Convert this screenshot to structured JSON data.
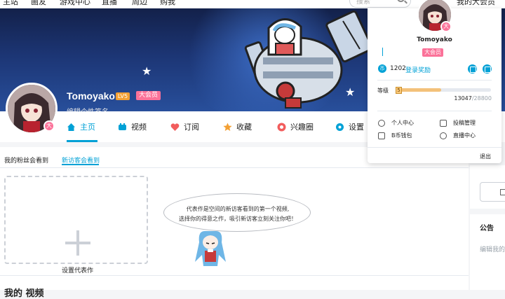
{
  "topnav": {
    "items": [
      "主站",
      "画友",
      "游戏中心",
      "直播",
      "周边",
      "购我"
    ],
    "search_placeholder": "搜索",
    "right_label": "我的大会员"
  },
  "profile": {
    "name": "Tomoyako",
    "level_badge": "LV5",
    "vip_badge": "大会员",
    "signature": "编辑个性签名",
    "avatar_badge": "大"
  },
  "tabs": [
    {
      "label": "主页",
      "icon": "home-icon"
    },
    {
      "label": "视频",
      "icon": "video-icon"
    },
    {
      "label": "订阅",
      "icon": "heart-icon"
    },
    {
      "label": "收藏",
      "icon": "star-icon"
    },
    {
      "label": "兴趣圈",
      "icon": "interest-circle-icon"
    },
    {
      "label": "设置",
      "icon": "gear-icon"
    }
  ],
  "main": {
    "subtabs": [
      "我的粉丝会看到",
      "新访客会看到"
    ],
    "placeholder_label": "设置代表作",
    "bubble_line1": "代表作是空间的新访客看到的第一个视频,",
    "bubble_line2": "选择你的得意之作，吸引新访客立刻关注你吧！",
    "bottom_title": "我的 视频"
  },
  "sidebar": {
    "notice_title": "公告",
    "notice_text": "编辑我的公告"
  },
  "dropdown": {
    "name": "Tomoyako",
    "vip_label": "大会员",
    "avatar_badge": "大",
    "coin_icon": "币",
    "coins": "1202",
    "coin_link": "登录奖励",
    "level_label": "等级",
    "level_badge": "5",
    "exp_current": "13047",
    "exp_max": "/28800",
    "exp_progress": 0.453,
    "menu": [
      {
        "label": "个人中心",
        "icon": "user-icon"
      },
      {
        "label": "投稿管理",
        "icon": "upload-manage-icon"
      },
      {
        "label": "B币钱包",
        "icon": "wallet-icon"
      },
      {
        "label": "直播中心",
        "icon": "live-center-icon"
      }
    ],
    "logout": "退出"
  },
  "colors": {
    "accent": "#00a1d6",
    "pink": "#fb7299",
    "level": "#f3a034"
  }
}
